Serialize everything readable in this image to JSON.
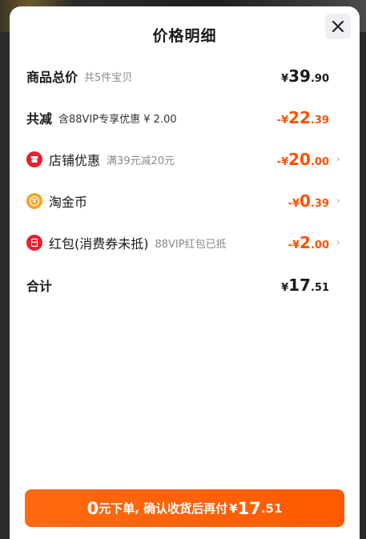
{
  "header": {
    "title": "价格明细"
  },
  "rows": {
    "total": {
      "label": "商品总价",
      "sub": "共5件宝贝",
      "yen": "¥",
      "int": "39",
      "dec": ".90"
    },
    "reduce": {
      "label": "共减",
      "sub": "含88VIP专享优惠 ¥ 2.00",
      "sign": "-",
      "yen": "¥",
      "int": "22",
      "dec": ".39"
    },
    "shop_discount": {
      "label": "店铺优惠",
      "sub": "满39元减20元",
      "sign": "-",
      "yen": "¥",
      "int": "20",
      "dec": ".00",
      "icon": "shop-icon"
    },
    "taojinbi": {
      "label": "淘金币",
      "sign": "-",
      "yen": "¥",
      "int": "0",
      "dec": ".39",
      "icon": "coin-icon"
    },
    "redpack": {
      "label": "红包(消费券未抵)",
      "sub": "88VIP红包已抵",
      "sign": "-",
      "yen": "¥",
      "int": "2",
      "dec": ".00",
      "icon": "red-packet-icon"
    },
    "sum": {
      "label": "合计",
      "yen": "¥",
      "int": "17",
      "dec": ".51"
    }
  },
  "cta": {
    "zero": "0",
    "text": "元下单, 确认收货后再付",
    "yen": "¥",
    "int": "17",
    "dec": ".51"
  },
  "colors": {
    "accent": "#ff5000",
    "button": "#ff5a00",
    "icon_red": "#e8202f",
    "icon_gold": "#f7a41d"
  }
}
